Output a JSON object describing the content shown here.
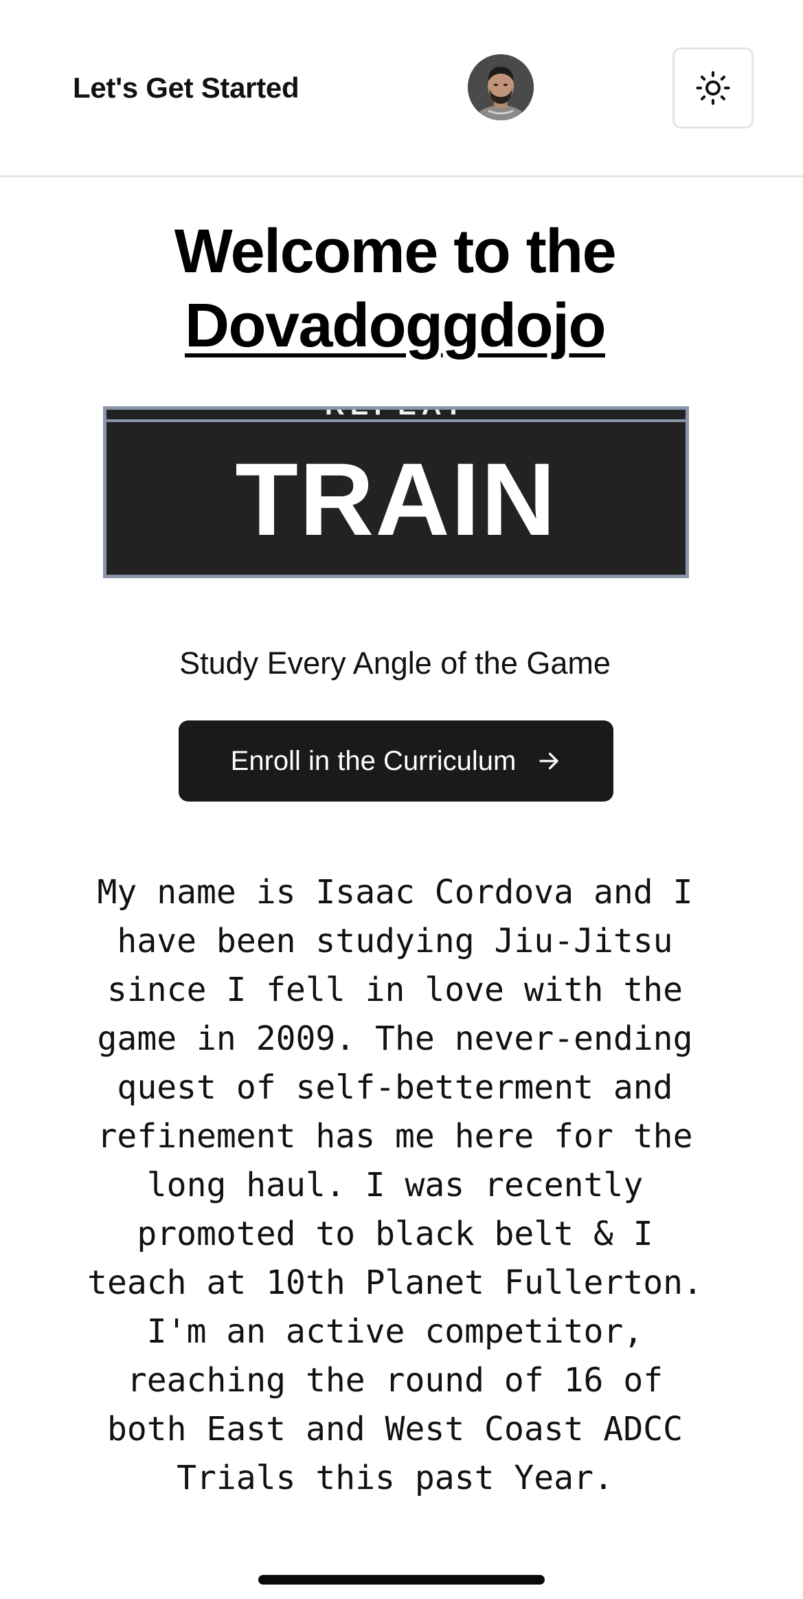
{
  "header": {
    "brand": "Let's Get Started",
    "avatar_alt": "avatar",
    "theme_icon": "sun-icon"
  },
  "hero": {
    "welcome_line1": "Welcome to the",
    "dojo_link": "Dovadoggdojo",
    "banner_top_text": "REPEAT",
    "banner_text": "TRAIN",
    "tagline": "Study Every Angle of the Game",
    "cta_label": "Enroll in the Curriculum",
    "cta_icon": "arrow-right-icon"
  },
  "bio": {
    "text": "My name is Isaac Cordova and I have been studying Jiu-Jitsu since I fell in love with the game in 2009. The never-ending quest of self-betterment and refinement has me here for the long haul. I was recently promoted to black belt & I teach at 10th Planet Fullerton. I'm an active competitor, reaching the round of 16 of both East and West Coast ADCC Trials this past Year."
  },
  "colors": {
    "cta_bg": "#1a1a1a",
    "banner_bg": "#222222",
    "banner_border": "#8b96aa",
    "divider": "#e4e4e7"
  }
}
